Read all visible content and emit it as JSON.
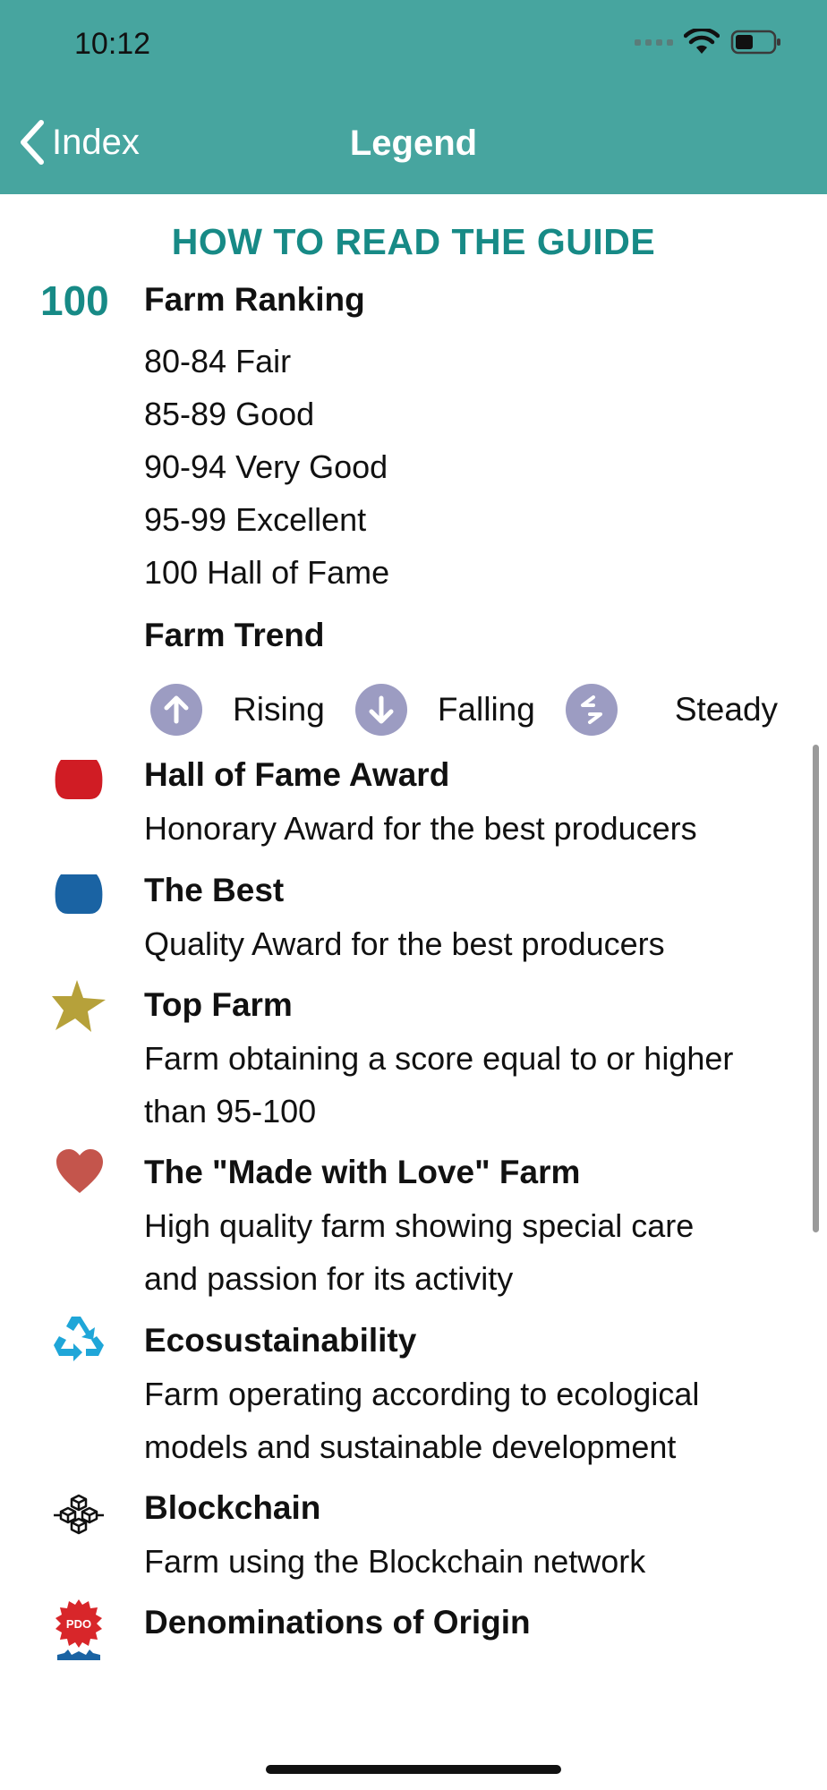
{
  "status_bar": {
    "time": "10:12"
  },
  "nav": {
    "back_label": "Index",
    "title": "Legend"
  },
  "guide": {
    "title": "HOW TO READ THE GUIDE",
    "ranking": {
      "number": "100",
      "label": "Farm Ranking",
      "levels": [
        "80-84 Fair",
        "85-89 Good",
        "90-94 Very Good",
        "95-99 Excellent",
        "100 Hall of Fame"
      ]
    },
    "trend": {
      "label": "Farm Trend",
      "items": [
        {
          "icon": "arrow-up-icon",
          "label": "Rising"
        },
        {
          "icon": "arrow-down-icon",
          "label": "Falling"
        },
        {
          "icon": "arrows-steady-icon",
          "label": "Steady"
        }
      ]
    },
    "awards": [
      {
        "icon": "hall-of-fame-badge-icon",
        "color": "#d01c24",
        "title": "Hall of Fame Award",
        "lines": [
          "Honorary Award for the best producers"
        ]
      },
      {
        "icon": "best-badge-icon",
        "color": "#1a63a3",
        "title": "The Best",
        "lines": [
          "Quality Award for the best producers"
        ]
      },
      {
        "icon": "star-icon",
        "color": "#b6a13a",
        "title": "Top Farm",
        "lines": [
          "Farm obtaining a score equal to or higher",
          "than 95-100"
        ]
      },
      {
        "icon": "heart-icon",
        "color": "#c4554c",
        "title": "The \"Made with Love\" Farm",
        "lines": [
          "High quality farm showing special care",
          "and passion for its activity"
        ]
      },
      {
        "icon": "recycle-icon",
        "color": "#1fa6d8",
        "title": "Ecosustainability",
        "lines": [
          "Farm operating according to ecological",
          "models and sustainable development"
        ]
      },
      {
        "icon": "blockchain-icon",
        "color": "#111111",
        "title": "Blockchain",
        "lines": [
          "Farm using the Blockchain network"
        ]
      },
      {
        "icon": "pdo-seal-icon",
        "color": "#d8262a",
        "title": "Denominations of Origin",
        "lines": []
      }
    ],
    "pdo_seal_text": "PDO"
  },
  "colors": {
    "header_bg": "#47a59f",
    "accent": "#178a86",
    "trend_icon_bg": "#9c9cc2"
  }
}
